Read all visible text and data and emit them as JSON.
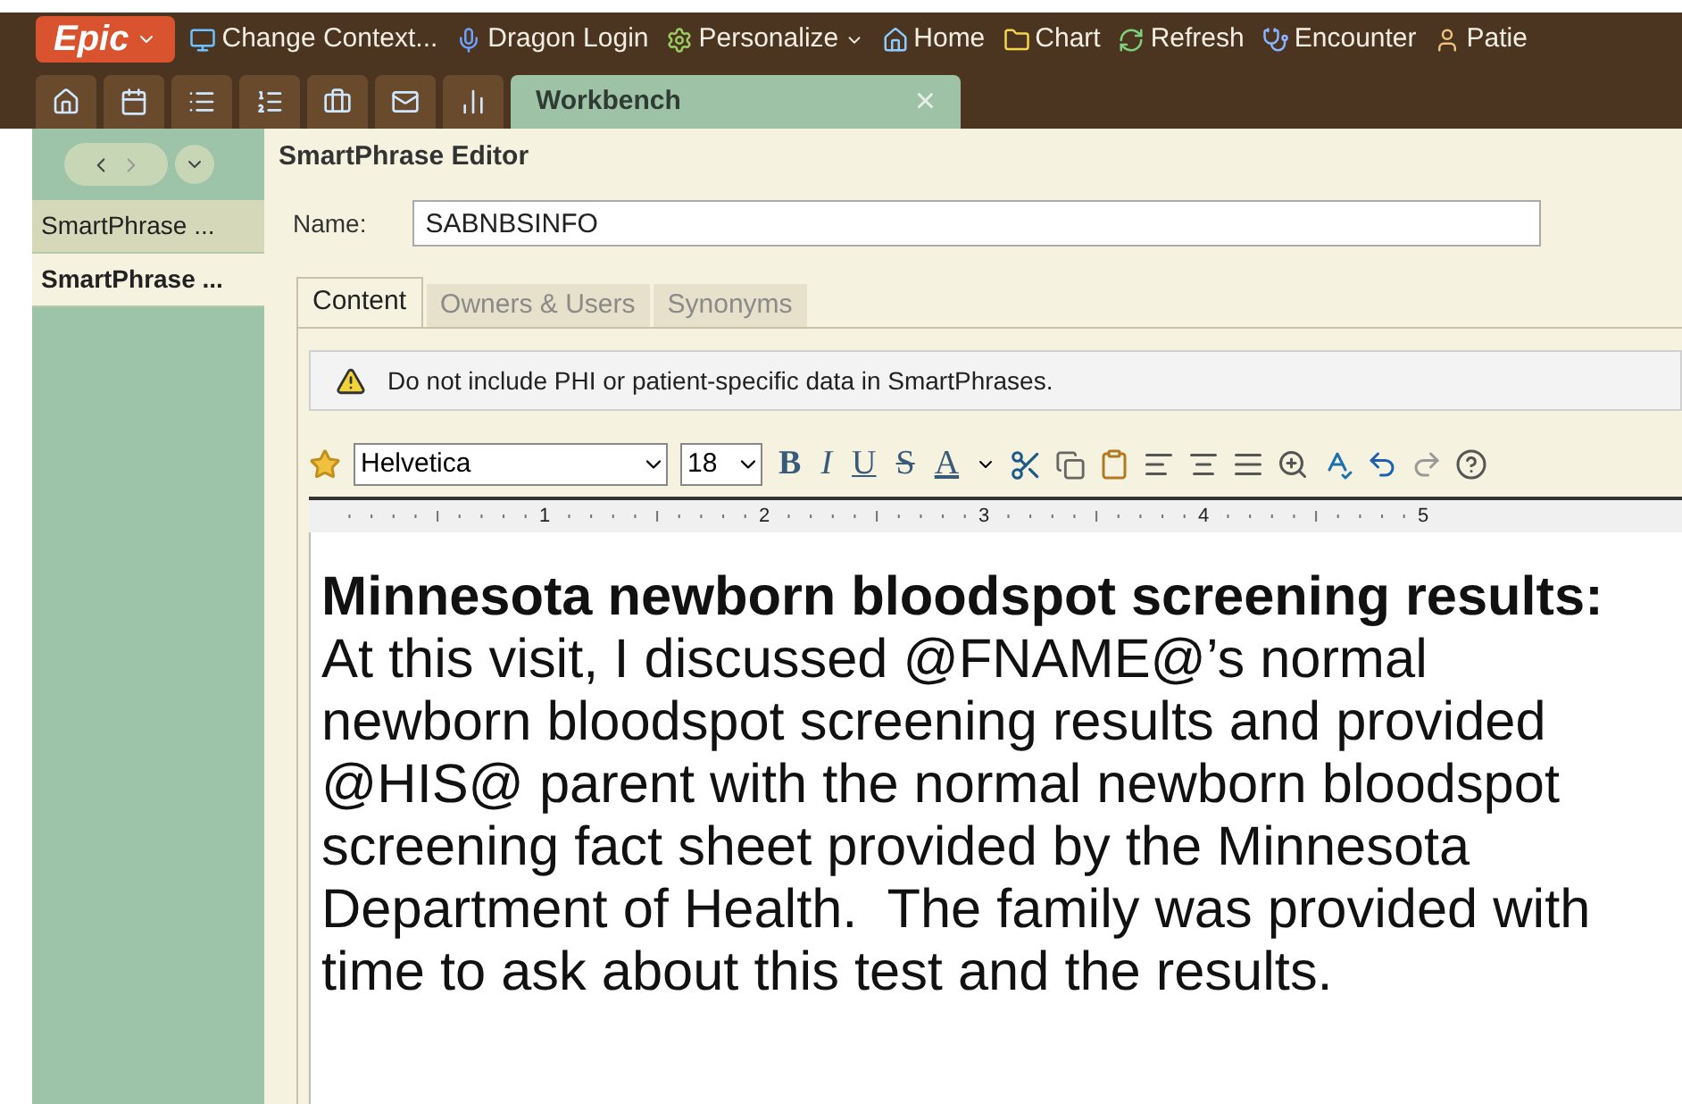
{
  "toolbar": {
    "logo": "Epic",
    "items": [
      {
        "label": "Change Context...",
        "kind": "context",
        "menu": false
      },
      {
        "label": "Dragon Login",
        "kind": "mic",
        "menu": false
      },
      {
        "label": "Personalize",
        "kind": "gear",
        "menu": true
      },
      {
        "label": "Home",
        "kind": "home",
        "menu": false
      },
      {
        "label": "Chart",
        "kind": "folder",
        "menu": false
      },
      {
        "label": "Refresh",
        "kind": "refresh",
        "menu": false
      },
      {
        "label": "Encounter",
        "kind": "stethoscope",
        "menu": false
      },
      {
        "label": "Patie",
        "kind": "person",
        "menu": false
      }
    ]
  },
  "tabs": [
    {
      "kind": "home",
      "selected": false
    },
    {
      "kind": "schedule",
      "selected": false
    },
    {
      "kind": "list",
      "selected": false
    },
    {
      "kind": "person-list",
      "selected": false
    },
    {
      "kind": "desk",
      "selected": false
    },
    {
      "kind": "mail",
      "selected": false
    },
    {
      "kind": "report",
      "selected": false
    },
    {
      "kind": "text",
      "label": "Workbench",
      "selected": true,
      "close": "×"
    }
  ],
  "sidebar": {
    "items": [
      {
        "label": "SmartPhrase ...",
        "selected": false
      },
      {
        "label": "SmartPhrase ...",
        "selected": true
      }
    ]
  },
  "editor": {
    "title": "SmartPhrase Editor",
    "name_label": "Name:",
    "name_value": "SABNBSINFO",
    "tabs": [
      {
        "label": "Content",
        "selected": true
      },
      {
        "label": "Owners & Users",
        "selected": false
      },
      {
        "label": "Synonyms",
        "selected": false
      }
    ],
    "warning": "Do not include PHI or patient-specific data in SmartPhrases.",
    "font": "Helvetica",
    "size": "18",
    "format_buttons": [
      {
        "label": "B",
        "kind": "bold"
      },
      {
        "label": "I",
        "kind": "italic"
      },
      {
        "label": "U",
        "kind": "underline"
      },
      {
        "label": "S",
        "kind": "strike"
      },
      {
        "label": "A",
        "kind": "color"
      }
    ],
    "ruler": [
      "1",
      "2",
      "3",
      "4",
      "5"
    ],
    "heading": "Minnesota newborn bloodspot screening results:",
    "body": "At this visit, I discussed @FNAME@’s normal newborn bloodspot screening results and provided @HIS@ parent with the normal newborn bloodspot screening fact sheet provided by the Minnesota Department of Health.  The family was provided with time to ask about this test and the results."
  }
}
